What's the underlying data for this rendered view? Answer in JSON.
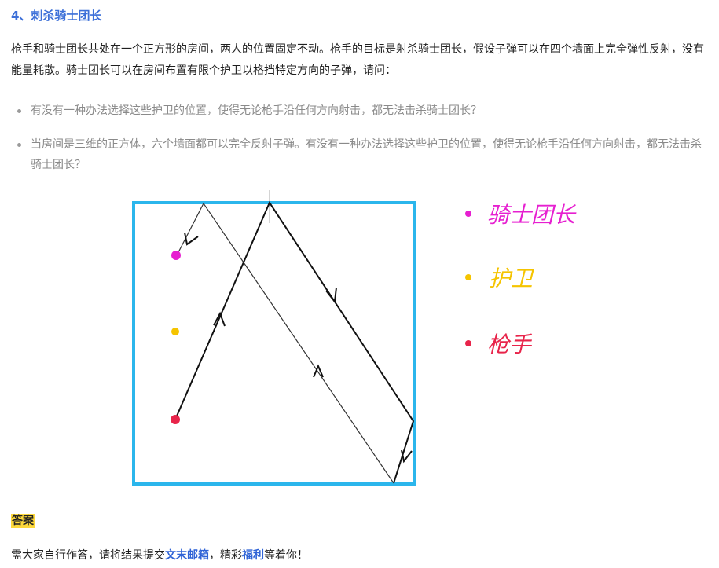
{
  "heading": "4、刺杀骑士团长",
  "intro": "枪手和骑士团长共处在一个正方形的房间，两人的位置固定不动。枪手的目标是射杀骑士团长，假设子弹可以在四个墙面上完全弹性反射，没有能量耗散。骑士团长可以在房间布置有限个护卫以格挡特定方向的子弹，请问：",
  "questions": [
    "有没有一种办法选择这些护卫的位置，使得无论枪手沿任何方向射击，都无法击杀骑士团长？",
    "当房间是三维的正方体，六个墙面都可以完全反射子弹。有没有一种办法选择这些护卫的位置，使得无论枪手沿任何方向射击，都无法击杀骑士团长？"
  ],
  "legend": [
    {
      "label": "骑士团长",
      "color": "#e61fd0"
    },
    {
      "label": "护卫",
      "color": "#f5c400"
    },
    {
      "label": "枪手",
      "color": "#e8244a"
    }
  ],
  "room_color": "#2bb6ec",
  "answer_tag": "答案",
  "closing": {
    "before": "需大家自行作答，请将结果提交",
    "link1": "文末邮箱",
    "middle": "，精彩",
    "link2": "福利",
    "after": "等着你！"
  }
}
